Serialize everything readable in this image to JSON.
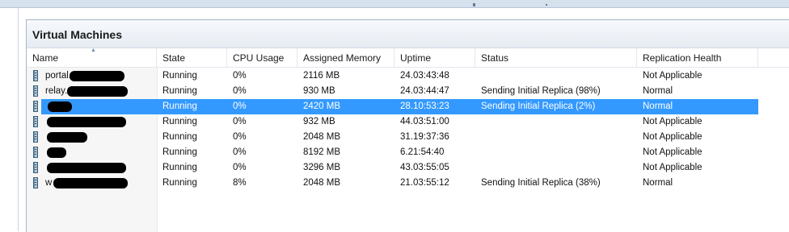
{
  "panel": {
    "title": "Virtual Machines"
  },
  "columns": [
    {
      "key": "name",
      "label": "Name"
    },
    {
      "key": "state",
      "label": "State"
    },
    {
      "key": "cpu",
      "label": "CPU Usage"
    },
    {
      "key": "memory",
      "label": "Assigned Memory"
    },
    {
      "key": "uptime",
      "label": "Uptime"
    },
    {
      "key": "status",
      "label": "Status"
    },
    {
      "key": "replication",
      "label": "Replication Health"
    }
  ],
  "sort": {
    "column": "name",
    "direction": "ascending"
  },
  "icons": {
    "vm": "virtual-machine-icon",
    "sort": "sort-ascending-icon"
  },
  "colors": {
    "selection": "#3399ff",
    "selection_text": "#ffffff"
  },
  "rows": [
    {
      "name": "portal.",
      "state": "Running",
      "cpu": "0%",
      "memory": "2116 MB",
      "uptime": "24.03:43:48",
      "status": "",
      "replication": "Not Applicable",
      "selected": false
    },
    {
      "name": "relay.",
      "state": "Running",
      "cpu": "0%",
      "memory": "930 MB",
      "uptime": "24.03:44:47",
      "status": "Sending Initial Replica (98%)",
      "replication": "Normal",
      "selected": false
    },
    {
      "name": "",
      "state": "Running",
      "cpu": "0%",
      "memory": "2420 MB",
      "uptime": "28.10:53:23",
      "status": "Sending Initial Replica (2%)",
      "replication": "Normal",
      "selected": true
    },
    {
      "name": "",
      "state": "Running",
      "cpu": "0%",
      "memory": "932 MB",
      "uptime": "44.03:51:00",
      "status": "",
      "replication": "Not Applicable",
      "selected": false
    },
    {
      "name": "",
      "state": "Running",
      "cpu": "0%",
      "memory": "2048 MB",
      "uptime": "31.19:37:36",
      "status": "",
      "replication": "Not Applicable",
      "selected": false
    },
    {
      "name": "",
      "state": "Running",
      "cpu": "0%",
      "memory": "8192 MB",
      "uptime": "6.21:54:40",
      "status": "",
      "replication": "Not Applicable",
      "selected": false
    },
    {
      "name": "",
      "state": "Running",
      "cpu": "0%",
      "memory": "3296 MB",
      "uptime": "43.03:55:05",
      "status": "",
      "replication": "Not Applicable",
      "selected": false
    },
    {
      "name": "w",
      "state": "Running",
      "cpu": "8%",
      "memory": "2048 MB",
      "uptime": "21.03:55:12",
      "status": "Sending Initial Replica (38%)",
      "replication": "Normal",
      "selected": false
    }
  ]
}
